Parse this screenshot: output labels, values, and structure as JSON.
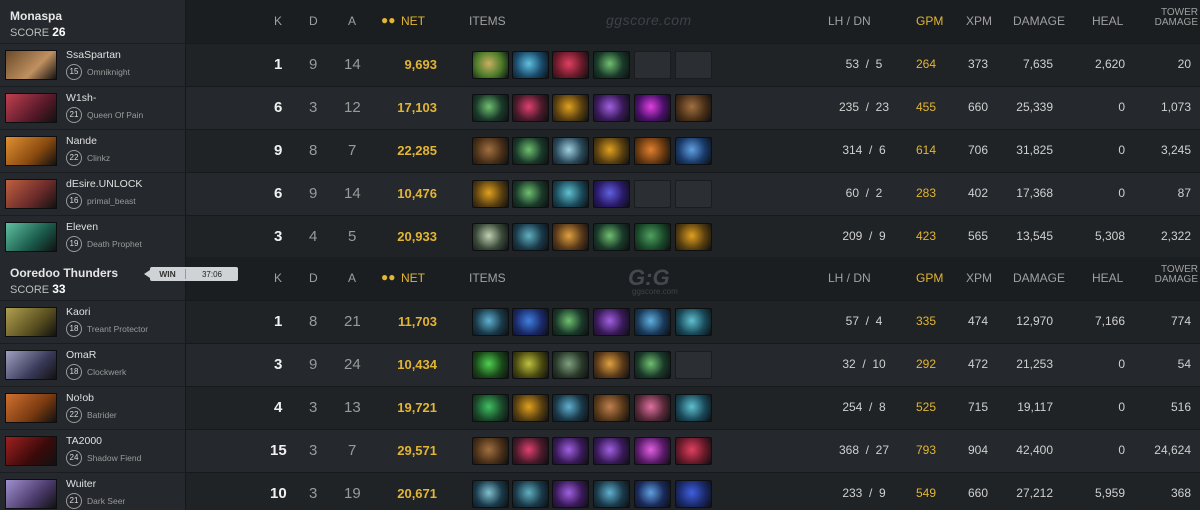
{
  "watermark": {
    "text": "ggscore.com",
    "logo": "G:G"
  },
  "headers": {
    "k": "K",
    "d": "D",
    "a": "A",
    "net": "NET",
    "items": "ITEMS",
    "lhdn": "LH  /  DN",
    "gpm": "GPM",
    "xpm": "XPM",
    "damage": "DAMAGE",
    "heal": "HEAL",
    "tower_line1": "TOWER",
    "tower_line2": "DAMAGE"
  },
  "match": {
    "result": "WIN",
    "duration": "37:06"
  },
  "teams": [
    {
      "name": "Monaspa",
      "score_label": "SCORE",
      "score": "26",
      "players": [
        {
          "name": "SsaSpartan",
          "level": "15",
          "hero": "Omniknight",
          "k": "1",
          "d": "9",
          "a": "14",
          "net": "9,693",
          "lhdn": "53  /  5",
          "gpm": "264",
          "xpm": "373",
          "damage": "7,635",
          "heal": "2,620",
          "tower": "20",
          "avatar": [
            "#c09060",
            "#6a4a2a"
          ],
          "items": [
            [
              "#4a7a2a",
              "#c8b060"
            ],
            [
              "#1a4a6a",
              "#60c0e0"
            ],
            [
              "#6a1a2a",
              "#e04060"
            ],
            [
              "#1a3a2a",
              "#70c070"
            ],
            null,
            null
          ]
        },
        {
          "name": "W1sh-",
          "level": "21",
          "hero": "Queen Of Pain",
          "k": "6",
          "d": "3",
          "a": "12",
          "net": "17,103",
          "lhdn": "235  /  23",
          "gpm": "455",
          "xpm": "660",
          "damage": "25,339",
          "heal": "0",
          "tower": "1,073",
          "avatar": [
            "#5a1a2a",
            "#c04050"
          ],
          "items": [
            [
              "#1a3a2a",
              "#70c070"
            ],
            [
              "#4a1a2a",
              "#e04070"
            ],
            [
              "#5a4010",
              "#e0a020"
            ],
            [
              "#3a1a5a",
              "#a060e0"
            ],
            [
              "#4a106a",
              "#e040e0"
            ],
            [
              "#4a3018",
              "#a07040"
            ]
          ]
        },
        {
          "name": "Nande",
          "level": "22",
          "hero": "Clinkz",
          "k": "9",
          "d": "8",
          "a": "7",
          "net": "22,285",
          "lhdn": "314  /  6",
          "gpm": "614",
          "xpm": "706",
          "damage": "31,825",
          "heal": "0",
          "tower": "3,245",
          "avatar": [
            "#8a4a10",
            "#e09030"
          ],
          "items": [
            [
              "#4a3018",
              "#a07040"
            ],
            [
              "#1a3a2a",
              "#70c070"
            ],
            [
              "#2a4a5a",
              "#a0d0e0"
            ],
            [
              "#5a4010",
              "#e0a020"
            ],
            [
              "#6a3a10",
              "#e08030"
            ],
            [
              "#1a3a6a",
              "#60a0e0"
            ]
          ]
        },
        {
          "name": "dEsire.UNLOCK",
          "level": "16",
          "hero": "primal_beast",
          "k": "6",
          "d": "9",
          "a": "14",
          "net": "10,476",
          "lhdn": "60  /  2",
          "gpm": "283",
          "xpm": "402",
          "damage": "17,368",
          "heal": "0",
          "tower": "87",
          "avatar": [
            "#6a2a2a",
            "#c06040"
          ],
          "items": [
            [
              "#5a4010",
              "#e0a020"
            ],
            [
              "#1a3a2a",
              "#70c070"
            ],
            [
              "#1a4a5a",
              "#60c0d0"
            ],
            [
              "#2a1a6a",
              "#6060e0"
            ],
            null,
            null
          ]
        },
        {
          "name": "Eleven",
          "level": "19",
          "hero": "Death Prophet",
          "k": "3",
          "d": "4",
          "a": "5",
          "net": "20,933",
          "lhdn": "209  /  9",
          "gpm": "423",
          "xpm": "565",
          "damage": "13,545",
          "heal": "5,308",
          "tower": "2,322",
          "avatar": [
            "#1a5a4a",
            "#60c0a0"
          ],
          "items": [
            [
              "#3a4a3a",
              "#c0d0b0"
            ],
            [
              "#1a3a4a",
              "#60b0c0"
            ],
            [
              "#5a3a1a",
              "#e0a040"
            ],
            [
              "#1a3a2a",
              "#70c070"
            ],
            [
              "#1a4a2a",
              "#50a060"
            ],
            [
              "#5a4010",
              "#e0a020"
            ]
          ]
        }
      ]
    },
    {
      "name": "Ooredoo Thunders",
      "score_label": "SCORE",
      "score": "33",
      "players": [
        {
          "name": "Kaori",
          "level": "18",
          "hero": "Treant Protector",
          "k": "1",
          "d": "8",
          "a": "21",
          "net": "11,703",
          "lhdn": "57  /  4",
          "gpm": "335",
          "xpm": "474",
          "damage": "12,970",
          "heal": "7,166",
          "tower": "774",
          "avatar": [
            "#5a5020",
            "#b0a050"
          ],
          "items": [
            [
              "#1a3a4a",
              "#60b0d0"
            ],
            [
              "#1a2a6a",
              "#4080e0"
            ],
            [
              "#1a3a2a",
              "#70c070"
            ],
            [
              "#3a1a5a",
              "#a060e0"
            ],
            [
              "#1a3a5a",
              "#60b0e0"
            ],
            [
              "#1a4a5a",
              "#60c0d0"
            ]
          ]
        },
        {
          "name": "OmaR",
          "level": "18",
          "hero": "Clockwerk",
          "k": "3",
          "d": "9",
          "a": "24",
          "net": "10,434",
          "lhdn": "32  /  10",
          "gpm": "292",
          "xpm": "472",
          "damage": "21,253",
          "heal": "0",
          "tower": "54",
          "avatar": [
            "#3a3a5a",
            "#a0a0c0"
          ],
          "items": [
            [
              "#1a4a1a",
              "#50d050"
            ],
            [
              "#4a4a10",
              "#c0c040"
            ],
            [
              "#2a3a2a",
              "#80a080"
            ],
            [
              "#5a3a1a",
              "#e0a040"
            ],
            [
              "#1a3a2a",
              "#70c070"
            ],
            null
          ]
        },
        {
          "name": "No!ob",
          "level": "22",
          "hero": "Batrider",
          "k": "4",
          "d": "3",
          "a": "13",
          "net": "19,721",
          "lhdn": "254  /  8",
          "gpm": "525",
          "xpm": "715",
          "damage": "19,117",
          "heal": "0",
          "tower": "516",
          "avatar": [
            "#7a3a10",
            "#d07030"
          ],
          "items": [
            [
              "#1a4a2a",
              "#40c060"
            ],
            [
              "#5a4010",
              "#e0a020"
            ],
            [
              "#1a3a4a",
              "#60b0d0"
            ],
            [
              "#5a3a1a",
              "#c08050"
            ],
            [
              "#5a2a3a",
              "#e070a0"
            ],
            [
              "#1a4a5a",
              "#60c0d0"
            ]
          ]
        },
        {
          "name": "TA2000",
          "level": "24",
          "hero": "Shadow Fiend",
          "k": "15",
          "d": "3",
          "a": "7",
          "net": "29,571",
          "lhdn": "368  /  27",
          "gpm": "793",
          "xpm": "904",
          "damage": "42,400",
          "heal": "0",
          "tower": "24,624",
          "avatar": [
            "#3a0a0a",
            "#a02020"
          ],
          "items": [
            [
              "#4a3018",
              "#a07040"
            ],
            [
              "#4a1a2a",
              "#e04070"
            ],
            [
              "#3a1a5a",
              "#a060e0"
            ],
            [
              "#3a1a5a",
              "#a060e0"
            ],
            [
              "#5a1a6a",
              "#e060e0"
            ],
            [
              "#6a1a2a",
              "#e04060"
            ]
          ]
        },
        {
          "name": "Wuiter",
          "level": "21",
          "hero": "Dark Seer",
          "k": "10",
          "d": "3",
          "a": "19",
          "net": "20,671",
          "lhdn": "233  /  9",
          "gpm": "549",
          "xpm": "660",
          "damage": "27,212",
          "heal": "5,959",
          "tower": "368",
          "avatar": [
            "#4a3a6a",
            "#a090d0"
          ],
          "items": [
            [
              "#1a3a4a",
              "#80c0d0"
            ],
            [
              "#1a3a4a",
              "#60b0c0"
            ],
            [
              "#3a1a5a",
              "#a060e0"
            ],
            [
              "#1a3a4a",
              "#60b0d0"
            ],
            [
              "#1a2a5a",
              "#60a0e0"
            ],
            [
              "#1a2a6a",
              "#4060e0"
            ]
          ]
        }
      ]
    }
  ]
}
